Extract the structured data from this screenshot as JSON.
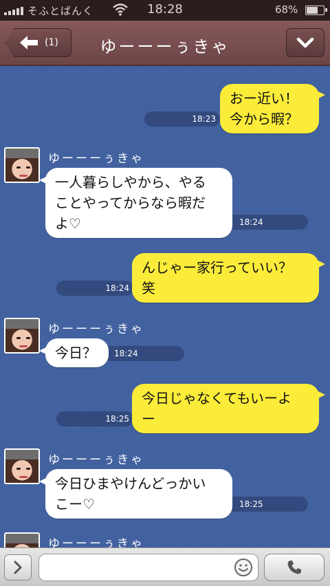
{
  "status_bar": {
    "carrier": "そふとばんく",
    "time": "18:28",
    "battery_percent": "68%",
    "battery_level": 0.68,
    "wifi_icon": "wifi-icon",
    "signal_icon": "signal-bars-icon"
  },
  "header": {
    "back_count": "(1)",
    "title": "ゆーーーぅきゃ",
    "back_icon": "arrow-left-icon",
    "menu_icon": "chevron-down-icon"
  },
  "messages": [
    {
      "side": "out",
      "text": "おー近い！\n今から暇？",
      "time": "18:23"
    },
    {
      "side": "in",
      "sender": "ゆーーーぅきゃ",
      "text": "一人暮らしやから、やる\nことやってからなら暇だ\nよ♡",
      "time": "18:24"
    },
    {
      "side": "out",
      "text": "んじゃー家行っていい？\n笑",
      "time": "18:24"
    },
    {
      "side": "in",
      "sender": "ゆーーーぅきゃ",
      "text": "今日？",
      "time": "18:24"
    },
    {
      "side": "out",
      "text": "今日じゃなくてもいーよ\nー",
      "time": "18:25"
    },
    {
      "side": "in",
      "sender": "ゆーーーぅきゃ",
      "text": "今日ひまやけんどっかい\nこー♡",
      "time": "18:25"
    },
    {
      "side": "in",
      "sender": "ゆーーーぅきゃ",
      "text": "",
      "time": ""
    }
  ],
  "input_bar": {
    "placeholder": "",
    "expand_icon": "chevron-right-icon",
    "emoji_icon": "smiley-icon",
    "call_icon": "phone-icon"
  },
  "colors": {
    "chat_bg": "#3f5f9e",
    "outgoing_bubble": "#fbec3a",
    "incoming_bubble": "#ffffff",
    "header_bg": "#7a4f50"
  }
}
